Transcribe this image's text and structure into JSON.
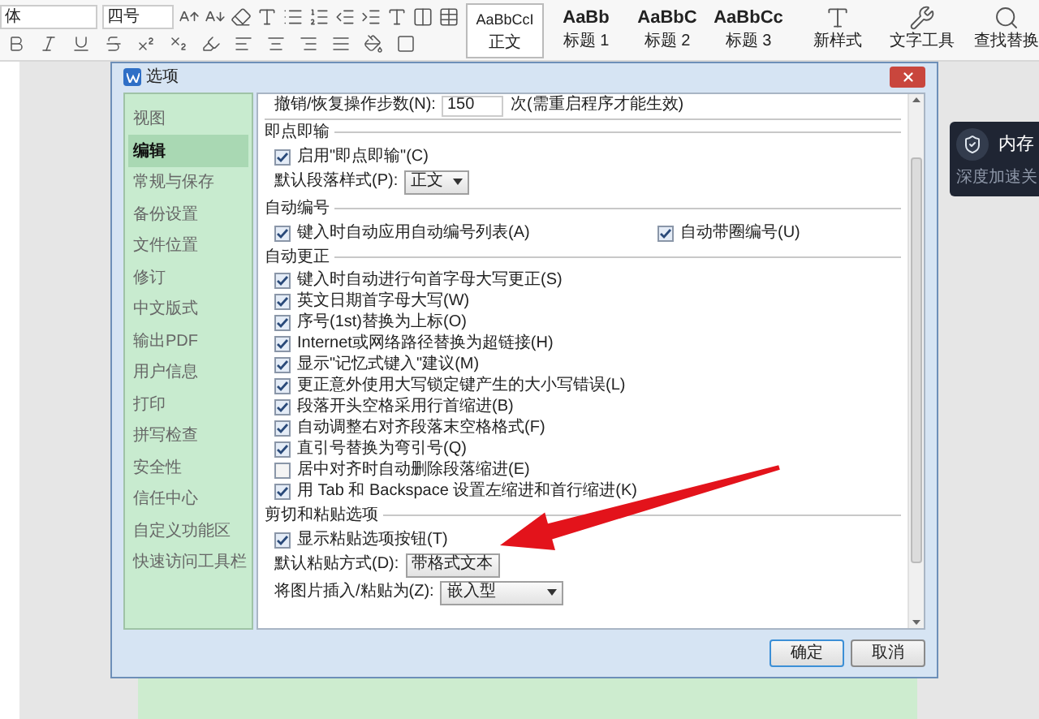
{
  "toolbar": {
    "font_box": "体",
    "size_box": "四号",
    "styles": [
      {
        "preview": "AaBbCcI",
        "label": "正文",
        "selected": true
      },
      {
        "preview": "AaBb",
        "label": "标题 1",
        "selected": false
      },
      {
        "preview": "AaBbC",
        "label": "标题 2",
        "selected": false
      },
      {
        "preview": "AaBbCc",
        "label": "标题 3",
        "selected": false
      }
    ],
    "tools": [
      {
        "label": "新样式"
      },
      {
        "label": "文字工具"
      },
      {
        "label": "查找替换"
      }
    ]
  },
  "dialog": {
    "title": "选项",
    "nav": [
      {
        "label": "视图",
        "selected": false
      },
      {
        "label": "编辑",
        "selected": true
      },
      {
        "label": "常规与保存",
        "selected": false
      },
      {
        "label": "备份设置",
        "selected": false
      },
      {
        "label": "文件位置",
        "selected": false
      },
      {
        "label": "修订",
        "selected": false
      },
      {
        "label": "中文版式",
        "selected": false
      },
      {
        "label": "输出PDF",
        "selected": false
      },
      {
        "label": "用户信息",
        "selected": false
      },
      {
        "label": "打印",
        "selected": false
      },
      {
        "label": "拼写检查",
        "selected": false
      },
      {
        "label": "安全性",
        "selected": false
      },
      {
        "label": "信任中心",
        "selected": false
      },
      {
        "label": "自定义功能区",
        "selected": false
      },
      {
        "label": "快速访问工具栏",
        "selected": false
      }
    ],
    "undo": {
      "label": "撤销/恢复操作步数(N):",
      "value": "150",
      "note": "次(需重启程序才能生效)"
    },
    "sections": [
      {
        "title": "即点即输",
        "rows": [
          {
            "kind": "checkbox",
            "label": "启用\"即点即输\"(C)",
            "checked": true
          },
          {
            "kind": "select",
            "label": "默认段落样式(P):",
            "value": "正文"
          }
        ]
      },
      {
        "title": "自动编号",
        "rows": [
          {
            "kind": "pair",
            "items": [
              {
                "label": "键入时自动应用自动编号列表(A)",
                "checked": true
              },
              {
                "label": "自动带圈编号(U)",
                "checked": true
              }
            ]
          }
        ]
      },
      {
        "title": "自动更正",
        "rows": [
          {
            "kind": "checkbox",
            "label": "键入时自动进行句首字母大写更正(S)",
            "checked": true
          },
          {
            "kind": "checkbox",
            "label": "英文日期首字母大写(W)",
            "checked": true
          },
          {
            "kind": "checkbox",
            "label": "序号(1st)替换为上标(O)",
            "checked": true
          },
          {
            "kind": "checkbox",
            "label": "Internet或网络路径替换为超链接(H)",
            "checked": true
          },
          {
            "kind": "checkbox",
            "label": "显示\"记忆式键入\"建议(M)",
            "checked": true
          },
          {
            "kind": "checkbox",
            "label": "更正意外使用大写锁定键产生的大小写错误(L)",
            "checked": true
          },
          {
            "kind": "checkbox",
            "label": "段落开头空格采用行首缩进(B)",
            "checked": true
          },
          {
            "kind": "checkbox",
            "label": "自动调整右对齐段落末空格格式(F)",
            "checked": true
          },
          {
            "kind": "checkbox",
            "label": "直引号替换为弯引号(Q)",
            "checked": true
          },
          {
            "kind": "checkbox",
            "label": "居中对齐时自动删除段落缩进(E)",
            "checked": false
          },
          {
            "kind": "checkbox",
            "label": "用 Tab 和 Backspace 设置左缩进和首行缩进(K)",
            "checked": true
          }
        ]
      },
      {
        "title": "剪切和粘贴选项",
        "rows": [
          {
            "kind": "checkbox",
            "label": "显示粘贴选项按钮(T)",
            "checked": true
          },
          {
            "kind": "select",
            "label": "默认粘贴方式(D):",
            "value": "带格式文本"
          },
          {
            "kind": "select",
            "label": "将图片插入/粘贴为(Z):",
            "value": "嵌入型"
          }
        ]
      }
    ],
    "buttons": [
      {
        "label": "确定",
        "default": true
      },
      {
        "label": "取消",
        "default": false
      }
    ]
  },
  "popup": {
    "title": "内存",
    "text": "深度加速关"
  }
}
